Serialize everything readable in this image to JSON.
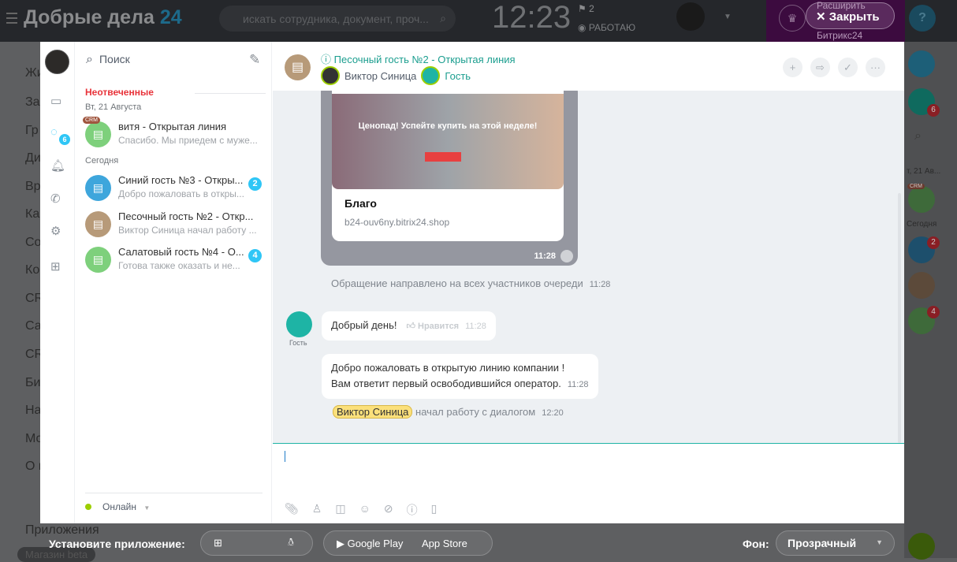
{
  "topbar": {
    "logo": "Добрые дела",
    "logo_num": "24",
    "search_placeholder": "искать сотрудника, документ, проч...",
    "time": "12:23",
    "flags": "2",
    "status": "РАБОТАЮ",
    "promo": "Расширить Битрикс24",
    "close": "Закрыть",
    "help": "?"
  },
  "bg_menu": [
    "Жи",
    "За",
    "Гр",
    "Ди",
    "Вр",
    "Ка",
    "Со",
    "Ко",
    "CR",
    "Са",
    "CR",
    "Би",
    "На",
    "Мо",
    "О к",
    "Приложения",
    "Магазин beta"
  ],
  "right_panel": {
    "counter_badge": "6",
    "date": "т, 21 Ав...",
    "today": "Сегодня",
    "crm": "CRM",
    "badges": [
      "2",
      "4"
    ]
  },
  "messenger": {
    "rail": {
      "openlines_badge": "6"
    },
    "search": "Поиск",
    "sections": {
      "unanswered": "Неотвеченные",
      "date": "Вт, 21 Августа",
      "today": "Сегодня"
    },
    "chats": [
      {
        "title": "витя - Открытая линия",
        "sub": "Спасибо. Мы приедем с муже...",
        "color": "#7ed07c",
        "crm": "CRM",
        "badge": ""
      },
      {
        "title": "Синий гость №3 - Откры...",
        "sub": "Добро пожаловать в откры...",
        "color": "#3ea6dc",
        "badge": "2"
      },
      {
        "title": "Песочный гость №2 - Откр...",
        "sub": "Виктор Синица начал работу ...",
        "color": "#b79a79",
        "badge": ""
      },
      {
        "title": "Салатовый гость №4 - О...",
        "sub": "Готова также оказать и не...",
        "color": "#7ed07c",
        "badge": "4"
      }
    ],
    "status": "Онлайн",
    "header": {
      "title": "Песочный гость №2 - Открытая линия",
      "operator": "Виктор Синица",
      "guest": "Гость"
    },
    "card": {
      "banner": "Ценопад! Успейте купить на этой неделе!",
      "name": "Благо",
      "url": "b24-ouv6ny.bitrix24.shop",
      "time": "11:28"
    },
    "messages": {
      "sys1": "Обращение направлено на всех участников очереди",
      "sys1_time": "11:28",
      "guest_label": "Гость",
      "m1": "Добрый день!",
      "like": "Нравится",
      "m1_time": "11:28",
      "m2a": "Добро пожаловать в открытую линию компании !",
      "m2b": "Вам ответит первый освободившийся оператор.",
      "m2_time": "11:28",
      "sys2_name": "Виктор Синица",
      "sys2": "начал работу с диалогом",
      "sys2_time": "12:20"
    }
  },
  "footer": {
    "install": "Установите приложение:",
    "google": "Google Play",
    "apple": "App Store",
    "bg_label": "Фон:",
    "bg_value": "Прозрачный"
  }
}
